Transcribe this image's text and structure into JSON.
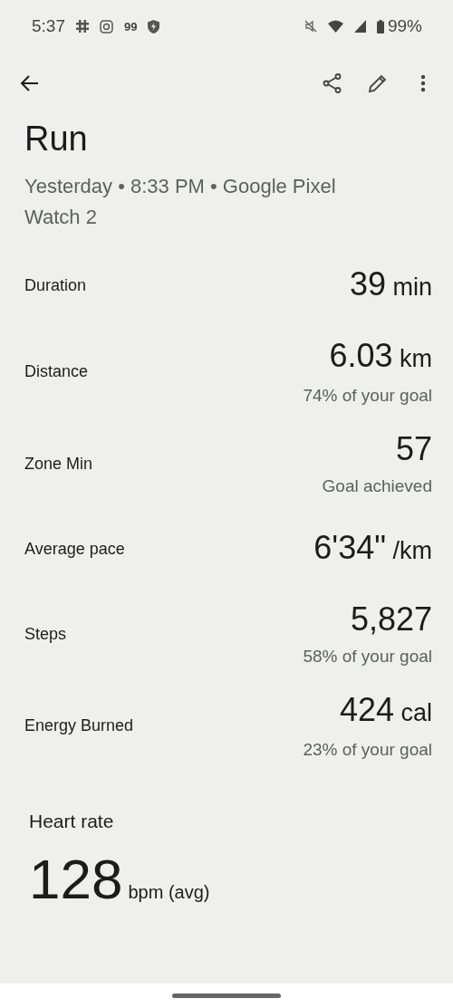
{
  "status_bar": {
    "time": "5:37",
    "notification_count": "99",
    "battery": "99%"
  },
  "title": "Run",
  "subtitle": "Yesterday • 8:33 PM • Google Pixel Watch 2",
  "stats": [
    {
      "label": "Duration",
      "value": "39",
      "unit": "min"
    },
    {
      "label": "Distance",
      "value": "6.03",
      "unit": "km",
      "note": "74% of your goal"
    },
    {
      "label": "Zone Min",
      "value": "57",
      "note": "Goal achieved"
    },
    {
      "label": "Average pace",
      "value": "6'34\"",
      "unit": "/km"
    },
    {
      "label": "Steps",
      "value": "5,827",
      "note": "58% of your goal"
    },
    {
      "label": "Energy Burned",
      "value": "424",
      "unit": "cal",
      "note": "23% of your goal"
    }
  ],
  "heart_rate": {
    "title": "Heart rate",
    "value": "128",
    "unit": "bpm (avg)"
  }
}
